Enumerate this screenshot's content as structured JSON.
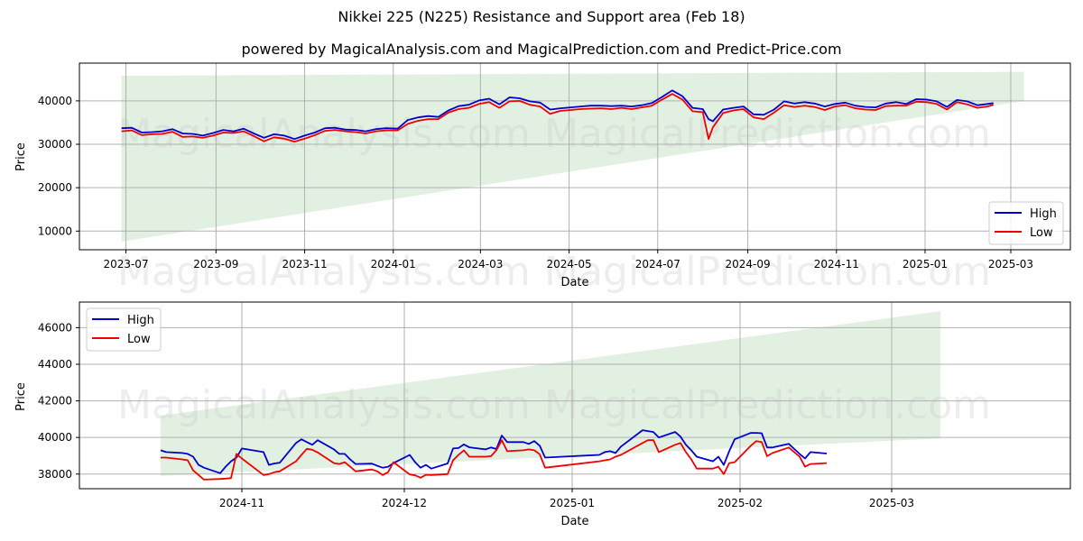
{
  "title": "Nikkei 225 (N225) Resistance and Support area (Feb 18)",
  "subtitle": "powered by MagicalAnalysis.com and MagicalPrediction.com and Predict-Price.com",
  "watermarks": [
    "MagicalAnalysis.com",
    "MagicalPrediction.com"
  ],
  "colors": {
    "high": "#0000cc",
    "low": "#ee0000",
    "band": "#d5ead5",
    "grid": "#b0b0b0"
  },
  "chart_data": [
    {
      "type": "line",
      "title": "",
      "xlabel": "Date",
      "ylabel": "Price",
      "xlim": [
        "2023-05-30",
        "2025-04-11"
      ],
      "ylim": [
        5700,
        48700
      ],
      "grid": true,
      "legend": {
        "position": "lower-right",
        "entries": [
          "High",
          "Low"
        ]
      },
      "x_ticks": [
        "2023-07",
        "2023-09",
        "2023-11",
        "2024-01",
        "2024-03",
        "2024-05",
        "2024-07",
        "2024-09",
        "2024-11",
        "2025-01",
        "2025-03"
      ],
      "y_ticks": [
        10000,
        20000,
        30000,
        40000
      ],
      "band": {
        "name": "Resistance and Support area",
        "start": "2023-06-28",
        "end": "2025-03-10",
        "top": [
          45800,
          46700
        ],
        "bottom": [
          7600,
          40000
        ]
      },
      "x": [
        "2023-06-28",
        "2023-07-05",
        "2023-07-12",
        "2023-07-19",
        "2023-07-26",
        "2023-08-02",
        "2023-08-09",
        "2023-08-16",
        "2023-08-23",
        "2023-08-30",
        "2023-09-06",
        "2023-09-13",
        "2023-09-20",
        "2023-09-27",
        "2023-10-04",
        "2023-10-11",
        "2023-10-18",
        "2023-10-25",
        "2023-11-01",
        "2023-11-08",
        "2023-11-15",
        "2023-11-22",
        "2023-11-29",
        "2023-12-06",
        "2023-12-13",
        "2023-12-20",
        "2023-12-27",
        "2024-01-04",
        "2024-01-11",
        "2024-01-18",
        "2024-01-25",
        "2024-02-01",
        "2024-02-08",
        "2024-02-15",
        "2024-02-22",
        "2024-02-29",
        "2024-03-07",
        "2024-03-14",
        "2024-03-21",
        "2024-03-28",
        "2024-04-04",
        "2024-04-11",
        "2024-04-18",
        "2024-04-25",
        "2024-05-02",
        "2024-05-09",
        "2024-05-16",
        "2024-05-23",
        "2024-05-30",
        "2024-06-06",
        "2024-06-13",
        "2024-06-20",
        "2024-06-27",
        "2024-07-04",
        "2024-07-11",
        "2024-07-18",
        "2024-07-25",
        "2024-08-01",
        "2024-08-05",
        "2024-08-08",
        "2024-08-15",
        "2024-08-22",
        "2024-08-29",
        "2024-09-05",
        "2024-09-12",
        "2024-09-19",
        "2024-09-26",
        "2024-10-03",
        "2024-10-10",
        "2024-10-17",
        "2024-10-24",
        "2024-10-31",
        "2024-11-07",
        "2024-11-14",
        "2024-11-21",
        "2024-11-28",
        "2024-12-05",
        "2024-12-12",
        "2024-12-19",
        "2024-12-26",
        "2025-01-02",
        "2025-01-09",
        "2025-01-16",
        "2025-01-23",
        "2025-01-30",
        "2025-02-06",
        "2025-02-13",
        "2025-02-17"
      ],
      "series": [
        {
          "name": "High",
          "values": [
            33700,
            33800,
            32700,
            32800,
            33000,
            33500,
            32500,
            32400,
            32000,
            32600,
            33300,
            33000,
            33600,
            32500,
            31500,
            32300,
            32000,
            31200,
            32000,
            32700,
            33700,
            33800,
            33400,
            33300,
            33000,
            33500,
            33700,
            33600,
            35600,
            36200,
            36500,
            36300,
            37800,
            38800,
            39100,
            40100,
            40500,
            39200,
            40800,
            40600,
            39900,
            39600,
            38000,
            38300,
            38500,
            38700,
            38900,
            38900,
            38800,
            38900,
            38700,
            39000,
            39500,
            40900,
            42400,
            41100,
            38400,
            38100,
            35800,
            35300,
            38000,
            38400,
            38700,
            36900,
            36800,
            38000,
            39900,
            39400,
            39700,
            39400,
            38700,
            39300,
            39600,
            38900,
            38600,
            38500,
            39400,
            39700,
            39300,
            40400,
            40300,
            39900,
            38600,
            40200,
            39900,
            39000,
            39300,
            39500
          ]
        },
        {
          "name": "Low",
          "values": [
            33000,
            33200,
            32100,
            32300,
            32400,
            32900,
            31700,
            31800,
            31500,
            32000,
            32700,
            32600,
            33000,
            31900,
            30700,
            31600,
            31300,
            30600,
            31300,
            32100,
            33100,
            33300,
            33000,
            32800,
            32500,
            33000,
            33200,
            33200,
            34700,
            35400,
            35800,
            35800,
            37300,
            38100,
            38400,
            39300,
            39700,
            38400,
            39900,
            40000,
            39100,
            38700,
            37000,
            37700,
            37900,
            38100,
            38200,
            38300,
            38100,
            38400,
            38100,
            38500,
            38900,
            40300,
            41600,
            40300,
            37600,
            37400,
            31200,
            33900,
            37200,
            37800,
            38100,
            36200,
            35800,
            37300,
            39000,
            38600,
            38900,
            38600,
            37900,
            38700,
            39000,
            38300,
            38000,
            37900,
            38800,
            38900,
            38900,
            39800,
            39700,
            39300,
            38000,
            39700,
            39200,
            38400,
            38700,
            39100
          ]
        }
      ]
    },
    {
      "type": "line",
      "title": "",
      "xlabel": "Date",
      "ylabel": "Price",
      "xlim": [
        "2024-10-02",
        "2025-04-03"
      ],
      "ylim": [
        37200,
        47400
      ],
      "grid": true,
      "legend": {
        "position": "upper-left",
        "entries": [
          "High",
          "Low"
        ]
      },
      "x_ticks": [
        "2024-11",
        "2024-12",
        "2025-01",
        "2025-02",
        "2025-03"
      ],
      "y_ticks": [
        38000,
        40000,
        42000,
        44000,
        46000
      ],
      "band": {
        "name": "Resistance and Support area",
        "start": "2024-10-17",
        "end": "2025-03-10",
        "top": [
          41200,
          46900
        ],
        "bottom": [
          37900,
          39950
        ]
      },
      "x": [
        "2024-10-17",
        "2024-10-18",
        "2024-10-21",
        "2024-10-22",
        "2024-10-23",
        "2024-10-24",
        "2024-10-25",
        "2024-10-28",
        "2024-10-29",
        "2024-10-30",
        "2024-10-31",
        "2024-11-01",
        "2024-11-05",
        "2024-11-06",
        "2024-11-07",
        "2024-11-08",
        "2024-11-11",
        "2024-11-12",
        "2024-11-13",
        "2024-11-14",
        "2024-11-15",
        "2024-11-18",
        "2024-11-19",
        "2024-11-20",
        "2024-11-21",
        "2024-11-22",
        "2024-11-25",
        "2024-11-26",
        "2024-11-27",
        "2024-11-28",
        "2024-11-29",
        "2024-12-02",
        "2024-12-03",
        "2024-12-04",
        "2024-12-05",
        "2024-12-06",
        "2024-12-09",
        "2024-12-10",
        "2024-12-11",
        "2024-12-12",
        "2024-12-13",
        "2024-12-16",
        "2024-12-17",
        "2024-12-18",
        "2024-12-19",
        "2024-12-20",
        "2024-12-23",
        "2024-12-24",
        "2024-12-25",
        "2024-12-26",
        "2024-12-27",
        "2025-01-06",
        "2025-01-07",
        "2025-01-08",
        "2025-01-09",
        "2025-01-10",
        "2025-01-14",
        "2025-01-15",
        "2025-01-16",
        "2025-01-17",
        "2025-01-20",
        "2025-01-21",
        "2025-01-22",
        "2025-01-23",
        "2025-01-24",
        "2025-01-27",
        "2025-01-28",
        "2025-01-29",
        "2025-01-30",
        "2025-01-31",
        "2025-02-03",
        "2025-02-04",
        "2025-02-05",
        "2025-02-06",
        "2025-02-07",
        "2025-02-10",
        "2025-02-12",
        "2025-02-13",
        "2025-02-14",
        "2025-02-17"
      ],
      "series": [
        {
          "name": "High",
          "values": [
            39300,
            39200,
            39150,
            39100,
            38950,
            38500,
            38350,
            38050,
            38400,
            38700,
            38900,
            39400,
            39200,
            38500,
            38580,
            38620,
            39700,
            39900,
            39750,
            39600,
            39850,
            39350,
            39100,
            39100,
            38800,
            38550,
            38570,
            38450,
            38350,
            38400,
            38600,
            39050,
            38650,
            38350,
            38500,
            38300,
            38580,
            39400,
            39420,
            39620,
            39460,
            39350,
            39450,
            39370,
            40100,
            39750,
            39750,
            39650,
            39800,
            39550,
            38900,
            39050,
            39200,
            39250,
            39150,
            39500,
            40400,
            40350,
            40300,
            40000,
            40300,
            40050,
            39600,
            39300,
            38950,
            38700,
            38950,
            38500,
            39250,
            39900,
            40250,
            40250,
            40230,
            39450,
            39450,
            39650,
            39100,
            38850,
            39200,
            39120,
            39200,
            39000,
            38900,
            39100,
            39550,
            39500
          ]
        },
        {
          "name": "Low",
          "values": [
            38900,
            38900,
            38800,
            38750,
            38200,
            37950,
            37700,
            37730,
            37750,
            37780,
            39100,
            38850,
            37950,
            38000,
            38100,
            38150,
            38700,
            39050,
            39380,
            39330,
            39180,
            38600,
            38550,
            38650,
            38400,
            38150,
            38250,
            38150,
            37950,
            38100,
            38650,
            37980,
            37930,
            37800,
            37960,
            37950,
            38000,
            38750,
            39050,
            39300,
            38950,
            38950,
            38980,
            39300,
            39850,
            39250,
            39300,
            39350,
            39300,
            39080,
            38350,
            38700,
            38750,
            38800,
            38950,
            39050,
            39700,
            39850,
            39850,
            39200,
            39600,
            39700,
            39200,
            38800,
            38300,
            38300,
            38400,
            38000,
            38600,
            38650,
            39550,
            39800,
            39750,
            38980,
            39150,
            39450,
            38950,
            38400,
            38550,
            38600,
            38800,
            38700,
            38600,
            38900,
            39100,
            39100
          ]
        }
      ]
    }
  ]
}
